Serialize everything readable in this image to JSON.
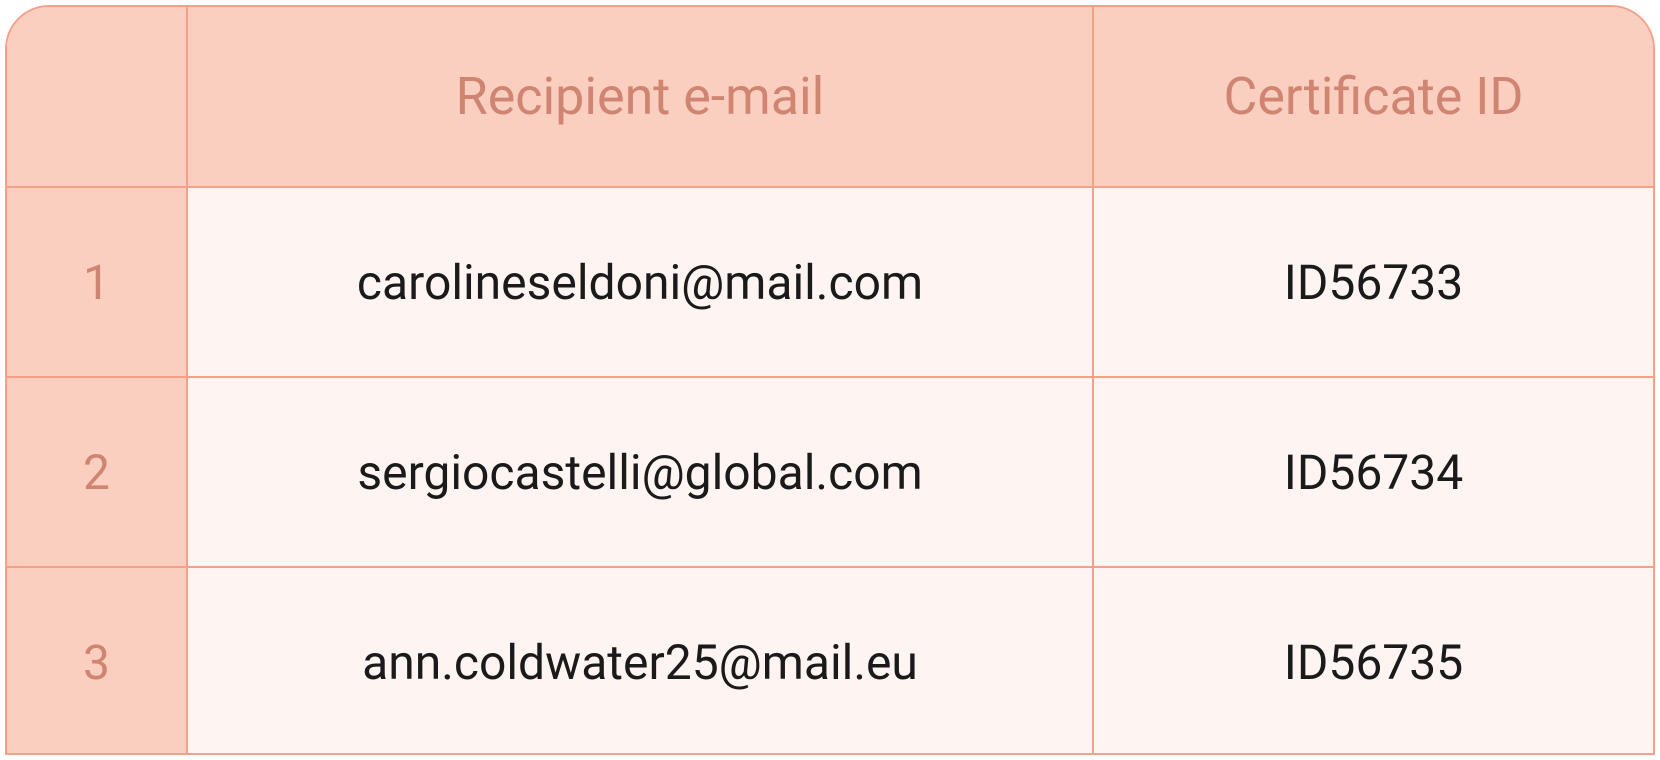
{
  "table": {
    "headers": {
      "index": "",
      "email": "Recipient e-mail",
      "cert": "Certificate ID"
    },
    "rows": [
      {
        "num": "1",
        "email": "carolineseldoni@mail.com",
        "cert": "ID56733"
      },
      {
        "num": "2",
        "email": "sergiocastelli@global.com",
        "cert": "ID56734"
      },
      {
        "num": "3",
        "email": "ann.coldwater25@mail.eu",
        "cert": "ID56735"
      }
    ]
  }
}
